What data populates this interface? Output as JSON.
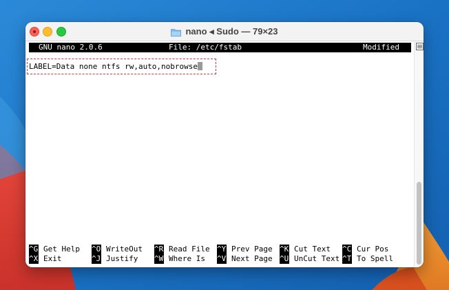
{
  "window": {
    "title": "nano ◂ Sudo — 79×23"
  },
  "nano": {
    "header": {
      "version": "GNU nano 2.0.6",
      "file": "File: /etc/fstab",
      "status": "Modified"
    },
    "content_line": "LABEL=Data none ntfs rw,auto,nobrowse",
    "shortcuts_row1": [
      {
        "key": "^G",
        "label": "Get Help"
      },
      {
        "key": "^O",
        "label": "WriteOut"
      },
      {
        "key": "^R",
        "label": "Read File"
      },
      {
        "key": "^Y",
        "label": "Prev Page"
      },
      {
        "key": "^K",
        "label": "Cut Text"
      },
      {
        "key": "^C",
        "label": "Cur Pos"
      }
    ],
    "shortcuts_row2": [
      {
        "key": "^X",
        "label": "Exit"
      },
      {
        "key": "^J",
        "label": "Justify"
      },
      {
        "key": "^W",
        "label": "Where Is"
      },
      {
        "key": "^V",
        "label": "Next Page"
      },
      {
        "key": "^U",
        "label": "UnCut Text"
      },
      {
        "key": "^T",
        "label": "To Spell"
      }
    ]
  },
  "colors": {
    "wallpaper_blue": "#1b78c8",
    "highlight": "#d03a3a",
    "close": "#ff5f57",
    "minimize": "#febc2e",
    "zoom": "#28c840"
  }
}
